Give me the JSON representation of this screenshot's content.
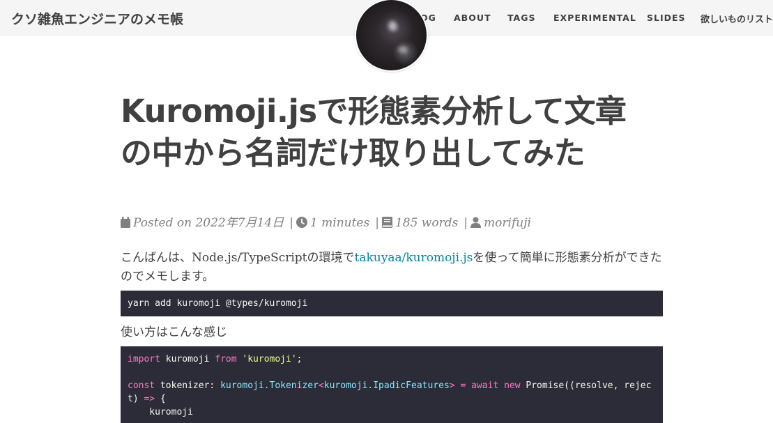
{
  "site": {
    "brand": "クソ雑魚エンジニアのメモ帳"
  },
  "nav": {
    "blog": "BLOG",
    "about": "ABOUT",
    "tags": "TAGS",
    "experimental": "EXPERIMENTAL",
    "slides": "SLIDES",
    "wishlist": "欲しいものリスト"
  },
  "article": {
    "title": "Kuromoji.jsで形態素分析して文章の中から名詞だけ取り出してみた",
    "meta": {
      "posted": "Posted on 2022年7月14日",
      "reading_time": "1 minutes",
      "words": "185 words",
      "author": "morifuji"
    },
    "intro_before": "こんばんは、Node.js/TypeScriptの環境で",
    "intro_link": "takuyaa/kuromoji.js",
    "intro_after": "を使って簡単に形態素分析ができたのでメモします。",
    "install_command": "yarn add kuromoji @types/kuromoji",
    "usage_heading": "使い方はこんな感じ",
    "code": {
      "import_kw": "import",
      "import_name": " kuromoji ",
      "from_kw": "from",
      "module": "'kuromoji'",
      "semi": ";",
      "const_kw": "const",
      "decl": " tokenizer: ",
      "type1": "kuromoji.Tokenizer",
      "lt": "<",
      "type2": "kuromoji.IpadicFeatures",
      "gt": "> ",
      "eq": "=",
      "await_kw": " await",
      "new_kw": " new",
      "promise": " Promise((resolve, rejec",
      "wrap": "t) ",
      "arrow": "=>",
      "brace": " {",
      "line3": "    kuromoji"
    }
  },
  "icons": {
    "calendar": "calendar-icon",
    "clock": "clock-icon",
    "book": "book-icon",
    "user": "user-icon"
  },
  "colors": {
    "link": "#0085a1",
    "code_bg": "#2b2c38"
  }
}
